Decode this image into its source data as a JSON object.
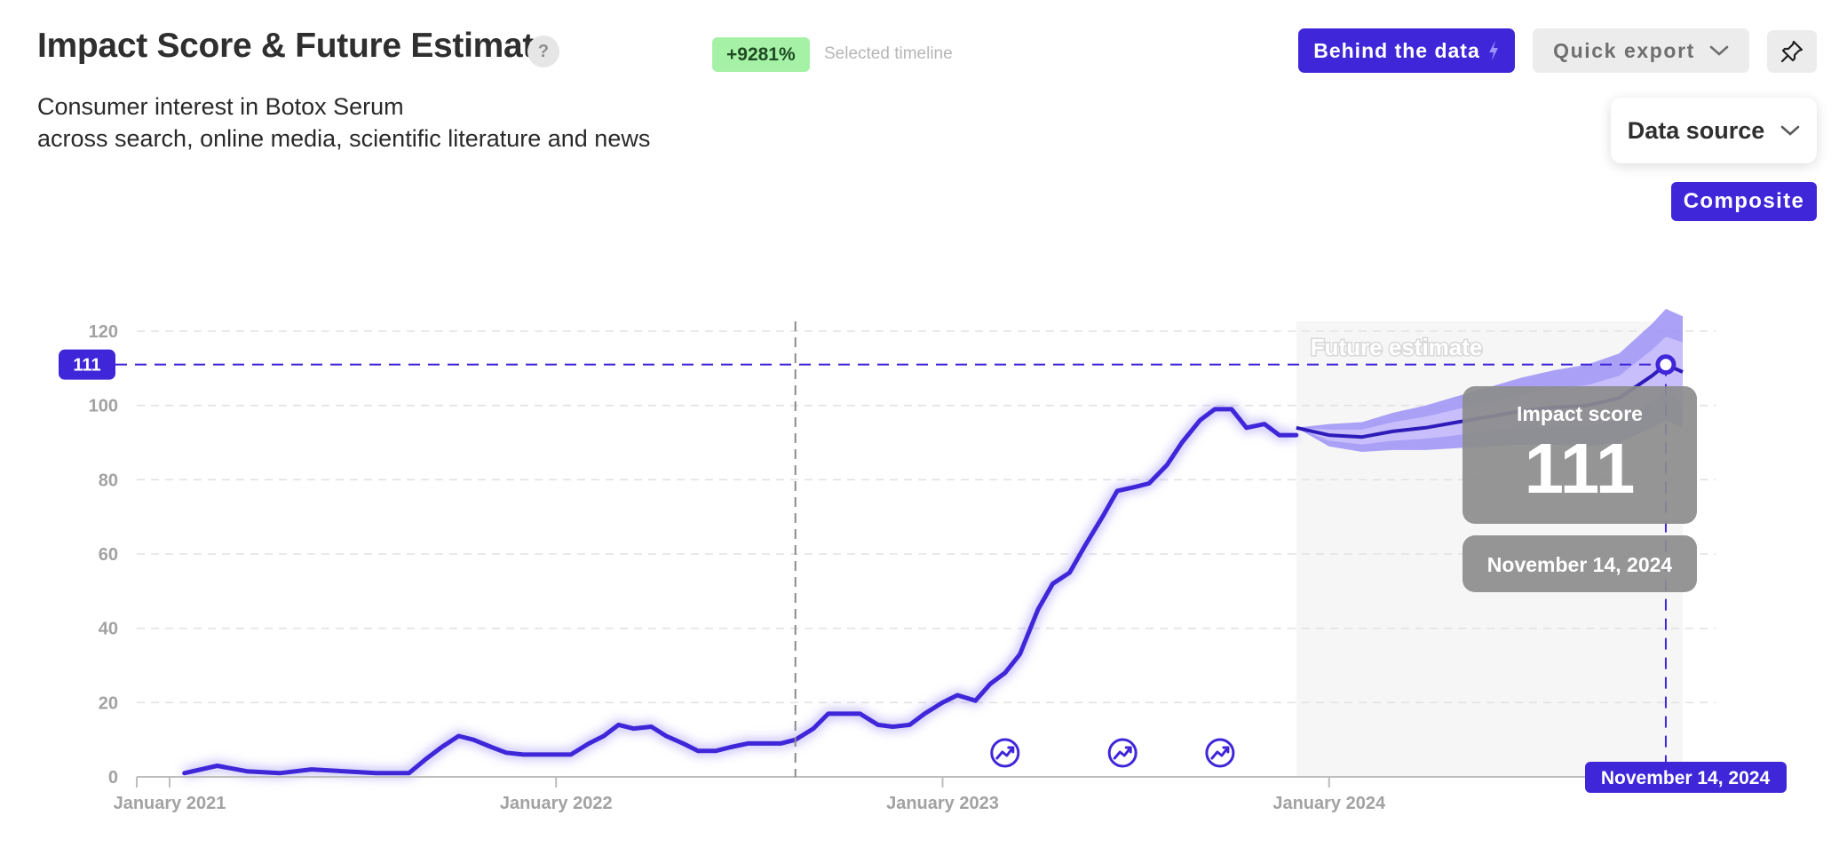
{
  "header": {
    "title": "Impact Score & Future Estimate",
    "help_icon": "?",
    "growth_badge": "+9281%",
    "growth_caption": "Selected timeline",
    "subtitle_line1": "Consumer interest in Botox Serum",
    "subtitle_line2": "across search, online media, scientific literature and news"
  },
  "toolbar": {
    "behind_label": "Behind the data",
    "behind_icon": "lightning-icon",
    "export_label": "Quick export",
    "export_icon": "chevron-down-icon",
    "pin_icon": "pin-icon",
    "source_label": "Data source",
    "source_icon": "chevron-down-icon",
    "composite_label": "Composite"
  },
  "colors": {
    "accent": "#3f26d9",
    "band_outer": "#9c90f6",
    "band_inner": "#c8c0fb",
    "badge_green": "#a5f2a6",
    "tooltip_gray": "#8c8c8c",
    "forecast_region": "#f6f6f6"
  },
  "chart_data": {
    "type": "line",
    "xlabel": "",
    "ylabel": "",
    "ylim": [
      0,
      120
    ],
    "y_ticks": [
      0,
      20,
      40,
      60,
      80,
      100,
      120
    ],
    "x_tick_labels": [
      "January 2021",
      "January 2022",
      "January 2023",
      "January 2024"
    ],
    "x_tick_dates": [
      "2021-01-01",
      "2022-01-01",
      "2023-01-01",
      "2024-01-01"
    ],
    "x_range": [
      "2020-12-01",
      "2024-12-31"
    ],
    "grid": true,
    "future_label": "Future estimate",
    "future_start": "2023-12-01",
    "future_end": "2024-11-30",
    "selected_date": "2022-08-15",
    "highlight_value": 111,
    "highlight_value_label": "111",
    "tooltip": {
      "title": "Impact score",
      "value": "111",
      "date": "November 14, 2024"
    },
    "date_marker_label": "November 14, 2024",
    "event_dates": [
      "2023-03-01",
      "2023-06-20",
      "2023-09-20"
    ],
    "event_icon": "trend-up-icon",
    "series": [
      {
        "x": [
          "2021-01-15",
          "2021-02-15",
          "2021-03-15",
          "2021-04-15",
          "2021-05-15",
          "2021-06-15",
          "2021-07-15",
          "2021-08-01",
          "2021-08-15",
          "2021-09-01",
          "2021-09-15",
          "2021-10-01",
          "2021-10-15",
          "2021-11-01",
          "2021-11-15",
          "2021-12-01",
          "2021-12-15",
          "2022-01-15",
          "2022-02-01",
          "2022-02-15",
          "2022-03-01",
          "2022-03-15",
          "2022-04-01",
          "2022-04-15",
          "2022-05-01",
          "2022-05-15",
          "2022-06-01",
          "2022-06-15",
          "2022-07-01",
          "2022-07-15",
          "2022-08-01",
          "2022-08-15",
          "2022-09-01",
          "2022-09-15",
          "2022-10-01",
          "2022-10-15",
          "2022-11-01",
          "2022-11-15",
          "2022-12-01",
          "2022-12-15",
          "2023-01-01",
          "2023-01-15",
          "2023-02-01",
          "2023-02-15",
          "2023-03-01",
          "2023-03-15",
          "2023-04-01",
          "2023-04-15",
          "2023-05-01",
          "2023-05-15",
          "2023-06-01",
          "2023-06-15",
          "2023-07-01",
          "2023-07-15",
          "2023-08-01",
          "2023-08-15",
          "2023-09-01",
          "2023-09-15",
          "2023-10-01",
          "2023-10-15",
          "2023-11-01",
          "2023-11-15",
          "2023-12-01"
        ],
        "values": [
          1,
          3,
          1.5,
          1,
          2,
          1.5,
          1,
          1,
          1,
          5,
          8,
          11,
          10,
          8,
          6.5,
          6,
          6,
          6,
          9,
          11,
          14,
          13,
          13.5,
          11,
          9,
          7,
          7,
          8,
          9,
          9,
          9,
          10,
          13,
          17,
          17,
          17,
          14,
          13.5,
          14,
          17,
          20,
          22,
          20.5,
          25,
          28,
          33,
          45,
          52,
          55,
          62,
          70,
          77,
          78,
          79,
          84,
          90,
          96,
          99,
          99,
          94,
          95,
          92,
          92
        ]
      },
      {
        "x": [
          "2023-12-01",
          "2024-01-01",
          "2024-02-01",
          "2024-03-01",
          "2024-04-01",
          "2024-05-01",
          "2024-06-01",
          "2024-07-01",
          "2024-08-01",
          "2024-09-01",
          "2024-10-01",
          "2024-11-01",
          "2024-11-14",
          "2024-11-30"
        ],
        "values": [
          94,
          92,
          91.5,
          93,
          94,
          95.5,
          97,
          98.5,
          99.5,
          100,
          102,
          108,
          111,
          109
        ],
        "band_inner": [
          [
            94,
            94
          ],
          [
            90.5,
            93.5
          ],
          [
            89.5,
            93.5
          ],
          [
            90.5,
            95.5
          ],
          [
            91,
            97
          ],
          [
            92,
            99
          ],
          [
            93,
            101
          ],
          [
            94,
            103
          ],
          [
            94.5,
            104.5
          ],
          [
            94.5,
            105.5
          ],
          [
            96,
            108
          ],
          [
            101,
            115
          ],
          [
            103.5,
            118.5
          ],
          [
            101,
            117
          ]
        ],
        "band_outer": [
          [
            94,
            94
          ],
          [
            89,
            95
          ],
          [
            87.5,
            95.5
          ],
          [
            88,
            98
          ],
          [
            88,
            100
          ],
          [
            88.5,
            102.5
          ],
          [
            89,
            105
          ],
          [
            89.5,
            107.5
          ],
          [
            89.5,
            109.5
          ],
          [
            89,
            111
          ],
          [
            90,
            114
          ],
          [
            94,
            122
          ],
          [
            96,
            126
          ],
          [
            94,
            124
          ]
        ]
      }
    ]
  }
}
